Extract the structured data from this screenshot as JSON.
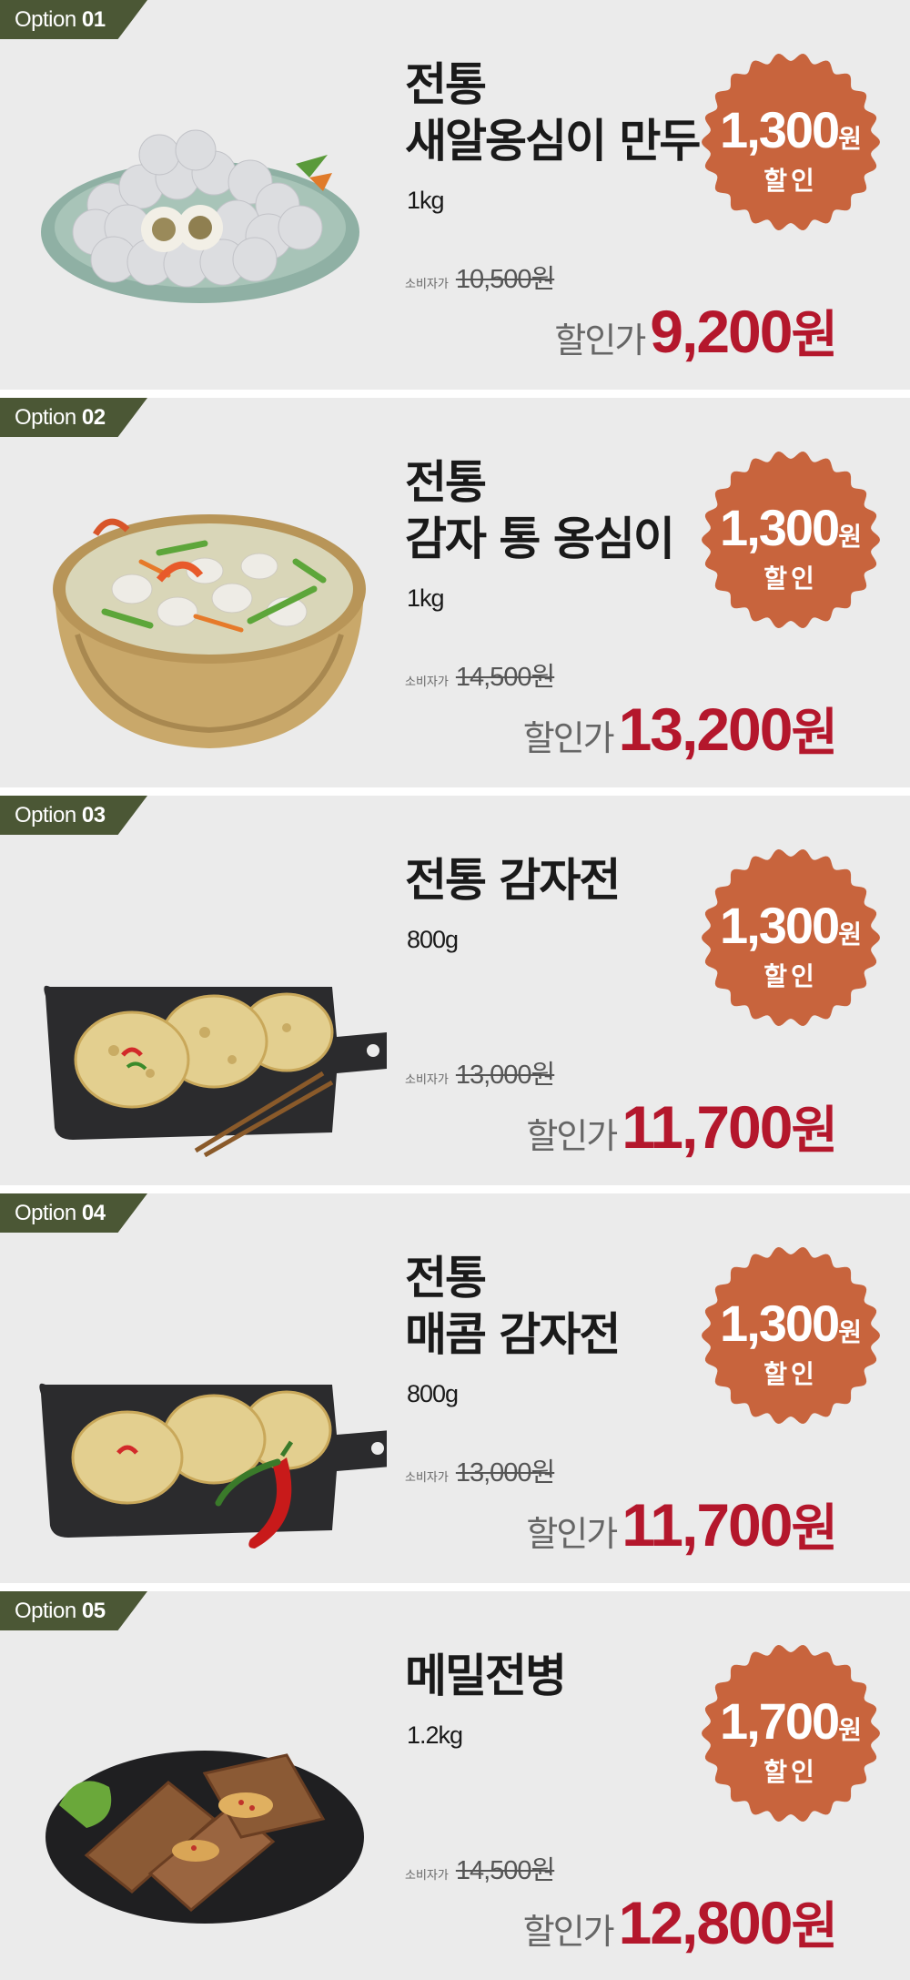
{
  "colors": {
    "tag_bg": "#4b5735",
    "badge": "#c8643d",
    "sale": "#b4172c",
    "bg": "#ebebeb"
  },
  "options": [
    {
      "tag_prefix": "Option ",
      "tag_num": "01",
      "title_lines": [
        "전통",
        "새알옹심이 만두"
      ],
      "weight": "1kg",
      "badge_amount": "1,300",
      "badge_unit": "원",
      "badge_label": "할인",
      "orig_label": "소비자가",
      "orig_price": "10,500원",
      "sale_label": "할인가",
      "sale_amount": "9,200",
      "sale_unit": "원",
      "photo_icon": "dumpling-plate-icon"
    },
    {
      "tag_prefix": "Option ",
      "tag_num": "02",
      "title_lines": [
        "전통",
        "감자 통 옹심이"
      ],
      "weight": "1kg",
      "badge_amount": "1,300",
      "badge_unit": "원",
      "badge_label": "할인",
      "orig_label": "소비자가",
      "orig_price": "14,500원",
      "sale_label": "할인가",
      "sale_amount": "13,200",
      "sale_unit": "원",
      "photo_icon": "soup-bowl-icon"
    },
    {
      "tag_prefix": "Option ",
      "tag_num": "03",
      "title_lines": [
        "전통 감자전"
      ],
      "weight": "800g",
      "badge_amount": "1,300",
      "badge_unit": "원",
      "badge_label": "할인",
      "orig_label": "소비자가",
      "orig_price": "13,000원",
      "sale_label": "할인가",
      "sale_amount": "11,700",
      "sale_unit": "원",
      "photo_icon": "potato-pancake-board-icon"
    },
    {
      "tag_prefix": "Option ",
      "tag_num": "04",
      "title_lines": [
        "전통",
        "매콤 감자전"
      ],
      "weight": "800g",
      "badge_amount": "1,300",
      "badge_unit": "원",
      "badge_label": "할인",
      "orig_label": "소비자가",
      "orig_price": "13,000원",
      "sale_label": "할인가",
      "sale_amount": "11,700",
      "sale_unit": "원",
      "photo_icon": "spicy-pancake-board-icon"
    },
    {
      "tag_prefix": "Option ",
      "tag_num": "05",
      "title_lines": [
        "메밀전병"
      ],
      "weight": "1.2kg",
      "badge_amount": "1,700",
      "badge_unit": "원",
      "badge_label": "할인",
      "orig_label": "소비자가",
      "orig_price": "14,500원",
      "sale_label": "할인가",
      "sale_amount": "12,800",
      "sale_unit": "원",
      "photo_icon": "buckwheat-crepe-plate-icon"
    }
  ]
}
